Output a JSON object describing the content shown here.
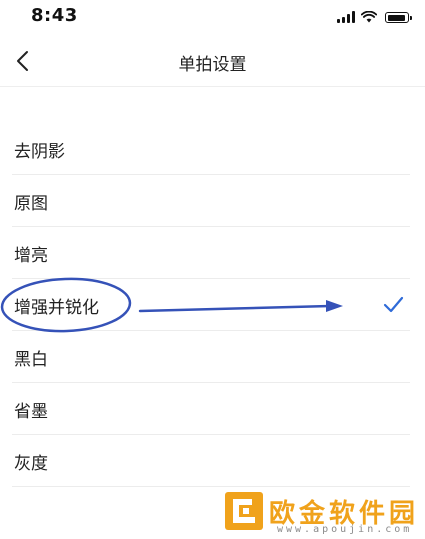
{
  "status_bar": {
    "time": "8:43"
  },
  "nav": {
    "title": "单拍设置",
    "back_icon": "chevron-left-icon"
  },
  "options": [
    {
      "label": "去阴影",
      "selected": false
    },
    {
      "label": "原图",
      "selected": false
    },
    {
      "label": "增亮",
      "selected": false
    },
    {
      "label": "增强并锐化",
      "selected": true
    },
    {
      "label": "黑白",
      "selected": false
    },
    {
      "label": "省墨",
      "selected": false
    },
    {
      "label": "灰度",
      "selected": false
    }
  ],
  "colors": {
    "accent": "#2f6bd8",
    "annotation": "#3552b8",
    "watermark": "#f0a21b"
  },
  "watermark": {
    "text": "欧金软件园",
    "url": "www.apoujin.com"
  }
}
